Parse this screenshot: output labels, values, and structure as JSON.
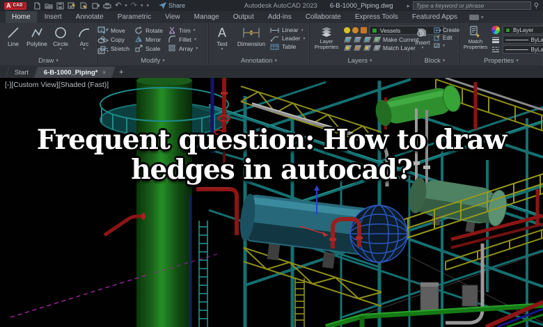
{
  "titlebar": {
    "app_badge_a": "A",
    "app_badge_cad": "CAD",
    "share_label": "Share",
    "app_title": "Autodesk AutoCAD 2023",
    "doc_title": "6-B-1000_Piping.dwg",
    "search_placeholder": "Type a keyword or phrase"
  },
  "ribbon": {
    "tabs": [
      "Home",
      "Insert",
      "Annotate",
      "Parametric",
      "View",
      "Manage",
      "Output",
      "Add-ins",
      "Collaborate",
      "Express Tools",
      "Featured Apps"
    ],
    "active_tab": "Home",
    "draw": {
      "label": "Draw",
      "line": "Line",
      "polyline": "Polyline",
      "circle": "Circle",
      "arc": "Arc"
    },
    "modify": {
      "label": "Modify",
      "move": "Move",
      "copy": "Copy",
      "stretch": "Stretch",
      "rotate": "Rotate",
      "mirror": "Mirror",
      "scale": "Scale",
      "trim": "Trim",
      "fillet": "Fillet",
      "array": "Array"
    },
    "annotation": {
      "label": "Annotation",
      "text": "Text",
      "dimension": "Dimension",
      "linear": "Linear",
      "leader": "Leader",
      "table": "Table"
    },
    "layers": {
      "label": "Layers",
      "layer_properties": "Layer Properties",
      "current_layer": "Vessels",
      "make_current": "Make Current",
      "match_layer": "Match Layer",
      "current_layer_color": "#2e9b2e"
    },
    "block": {
      "label": "Block",
      "insert": "Insert",
      "create": "Create",
      "edit": "Edit"
    },
    "properties": {
      "label": "Properties",
      "match_properties": "Match Properties",
      "color_value": "ByLayer",
      "lineweight_value": "ByLayer",
      "linetype_value": "ByLayer"
    }
  },
  "file_tabs": {
    "start": "Start",
    "active_doc": "6-B-1000_Piping*",
    "close_glyph": "×",
    "new_tab_glyph": "+"
  },
  "viewport": {
    "menu_control": "[-]",
    "view_control": "[Custom View]",
    "visual_style_control": "[Shaded (Fast)]"
  },
  "overlay": {
    "title": "Frequent question: How to draw hedges in autocad?",
    "line1": "Frequent question: How to draw",
    "line2": "hedges in autocad?"
  },
  "palette": {
    "chrome_bg": "#33373d",
    "titlebar_bg": "#23262b",
    "logo_red": "#b8232c",
    "steel_teal": "#156f70",
    "handrail_yellow": "#8f8f17",
    "pipe_red": "#8c1515",
    "column_green": "#1c661c",
    "drum_green": "#2f8f2f",
    "vessel_sage": "#4f8163",
    "exchanger_blue": "#27697a",
    "wireframe_blue": "#2c57c0",
    "pipe_gray": "#9a9a9a",
    "pipe_dark_blue": "#15156b",
    "dashed_magenta": "#9e239e",
    "overlay_text": "#ffffff"
  }
}
